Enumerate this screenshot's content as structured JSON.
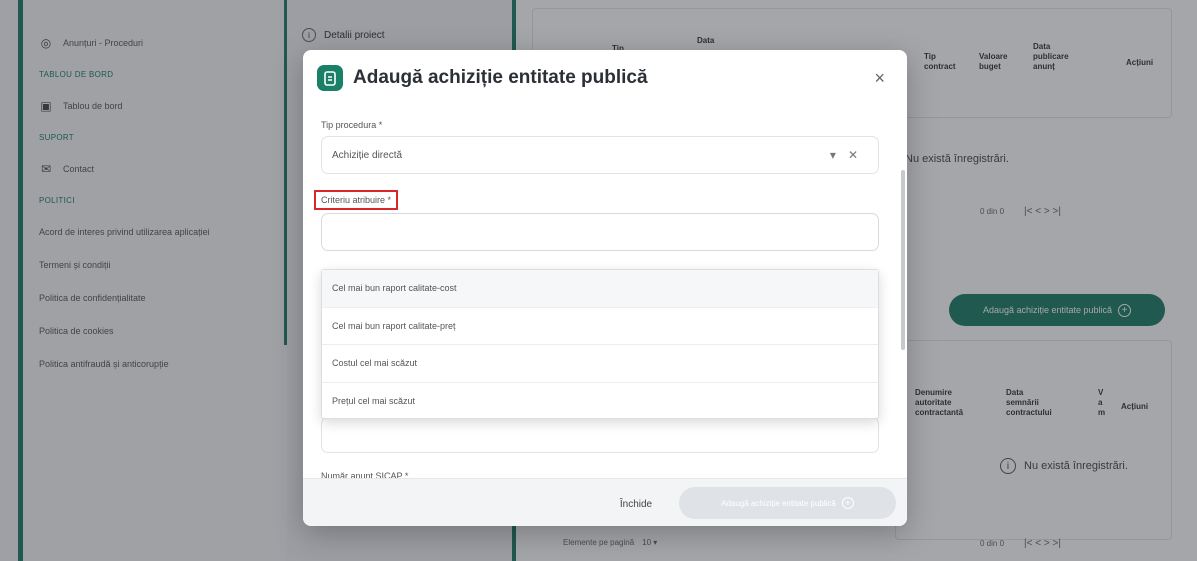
{
  "sidebar": {
    "items": [
      {
        "type": "item",
        "icon": "megaphone-icon",
        "label": "Anunțuri - Proceduri"
      },
      {
        "type": "section",
        "label": "TABLOU DE BORD"
      },
      {
        "type": "item",
        "icon": "dashboard-icon",
        "label": "Tablou de bord"
      },
      {
        "type": "section",
        "label": "SUPORT"
      },
      {
        "type": "item",
        "icon": "mail-icon",
        "label": "Contact"
      },
      {
        "type": "section",
        "label": "POLITICI"
      },
      {
        "type": "item",
        "icon": "",
        "label": "Acord de interes privind utilizarea aplicației"
      },
      {
        "type": "item",
        "icon": "",
        "label": "Termeni și condiții"
      },
      {
        "type": "item",
        "icon": "",
        "label": "Politica de confidențialitate"
      },
      {
        "type": "item",
        "icon": "",
        "label": "Politica de cookies"
      },
      {
        "type": "item",
        "icon": "",
        "label": "Politica antifraudă și anticorupție"
      }
    ]
  },
  "middle": {
    "header": "Detalii proiect"
  },
  "right_panel": {
    "top_table_headers": [
      "Tip",
      "Data",
      "Tip contract",
      "Valoare buget",
      "Data publicare anunț",
      "Acțiuni"
    ],
    "empty_message": "Nu există înregistrări.",
    "pager_label": "0 din 0",
    "pager_controls": "|<   <   >   >|",
    "add_button_label": "Adaugă achiziție entitate publică",
    "bottom_table_headers": [
      "Denumire autoritate contractantă",
      "Data semnării contractului",
      "V a m",
      "Acțiuni"
    ],
    "rows_per_page_label": "Elemente pe pagină",
    "rows_per_page_value": "10"
  },
  "modal": {
    "title": "Adaugă achiziție entitate publică",
    "close_glyph": "×",
    "fields": {
      "tip_procedura_label": "Tip procedura *",
      "tip_procedura_value": "Achiziție directă",
      "criteriu_label": "Criteriu atribuire *",
      "numar_anunt_label": "Număr anunț SICAP *"
    },
    "criteriu_options": [
      "Cel mai bun raport calitate-cost",
      "Cel mai bun raport calitate-preț",
      "Costul cel mai scăzut",
      "Prețul cel mai scăzut"
    ],
    "footer": {
      "close_label": "Închide",
      "submit_label": "Adaugă achiziție entitate publică"
    }
  },
  "colors": {
    "brand": "#1a7a62",
    "highlight": "#d9262b"
  }
}
